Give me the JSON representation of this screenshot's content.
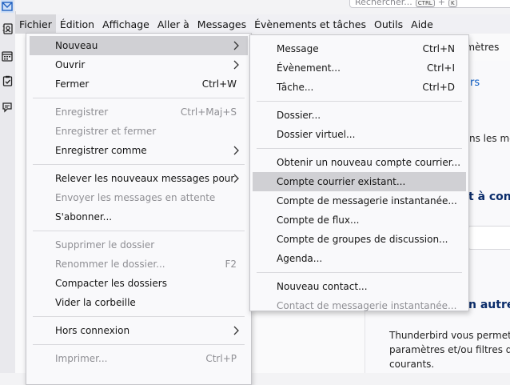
{
  "search": {
    "placeholder": "Rechercher...",
    "kbd1": "CTRL",
    "kbd_plus": "+",
    "kbd2": "K"
  },
  "spaces": [
    "mail-icon",
    "address-book-icon",
    "calendar-icon",
    "tasks-icon",
    "chat-icon"
  ],
  "menubar": [
    {
      "label": "Fichier",
      "open": true
    },
    {
      "label": "Édition"
    },
    {
      "label": "Affichage"
    },
    {
      "label": "Aller à"
    },
    {
      "label": "Messages"
    },
    {
      "label": "Évènements et tâches"
    },
    {
      "label": "Outils"
    },
    {
      "label": "Aide"
    }
  ],
  "background": {
    "tab_label": "amètres",
    "link1": "rs",
    "text1": "ns les mes",
    "heading1": "t à confi",
    "heading2": "n autre",
    "para": [
      "Thunderbird vous permet d'i",
      "paramètres et/ou filtres d'aut",
      "courants."
    ]
  },
  "file_menu": {
    "nouveau": "Nouveau",
    "ouvrir": "Ouvrir",
    "fermer": "Fermer",
    "fermer_sc": "Ctrl+W",
    "enregistrer": "Enregistrer",
    "enregistrer_sc": "Ctrl+Maj+S",
    "enregistrer_fermer": "Enregistrer et fermer",
    "enregistrer_comme": "Enregistrer comme",
    "relever": "Relever les nouveaux messages pour",
    "envoyer": "Envoyer les messages en attente",
    "abonner": "S'abonner...",
    "supprimer_dossier": "Supprimer le dossier",
    "renommer_dossier": "Renommer le dossier...",
    "renommer_sc": "F2",
    "compacter": "Compacter les dossiers",
    "vider": "Vider la corbeille",
    "hors_connexion": "Hors connexion",
    "imprimer": "Imprimer...",
    "imprimer_sc": "Ctrl+P"
  },
  "new_menu": {
    "message": "Message",
    "message_sc": "Ctrl+N",
    "evenement": "Évènement...",
    "evenement_sc": "Ctrl+I",
    "tache": "Tâche...",
    "tache_sc": "Ctrl+D",
    "dossier": "Dossier...",
    "dossier_virtuel": "Dossier virtuel...",
    "obtenir": "Obtenir un nouveau compte courrier...",
    "compte_existant": "Compte courrier existant...",
    "messagerie_instantanee": "Compte de messagerie instantanée...",
    "flux": "Compte de flux...",
    "groupes": "Compte de groupes de discussion...",
    "agenda": "Agenda...",
    "contact": "Nouveau contact...",
    "contact_im": "Contact de messagerie instantanée..."
  }
}
